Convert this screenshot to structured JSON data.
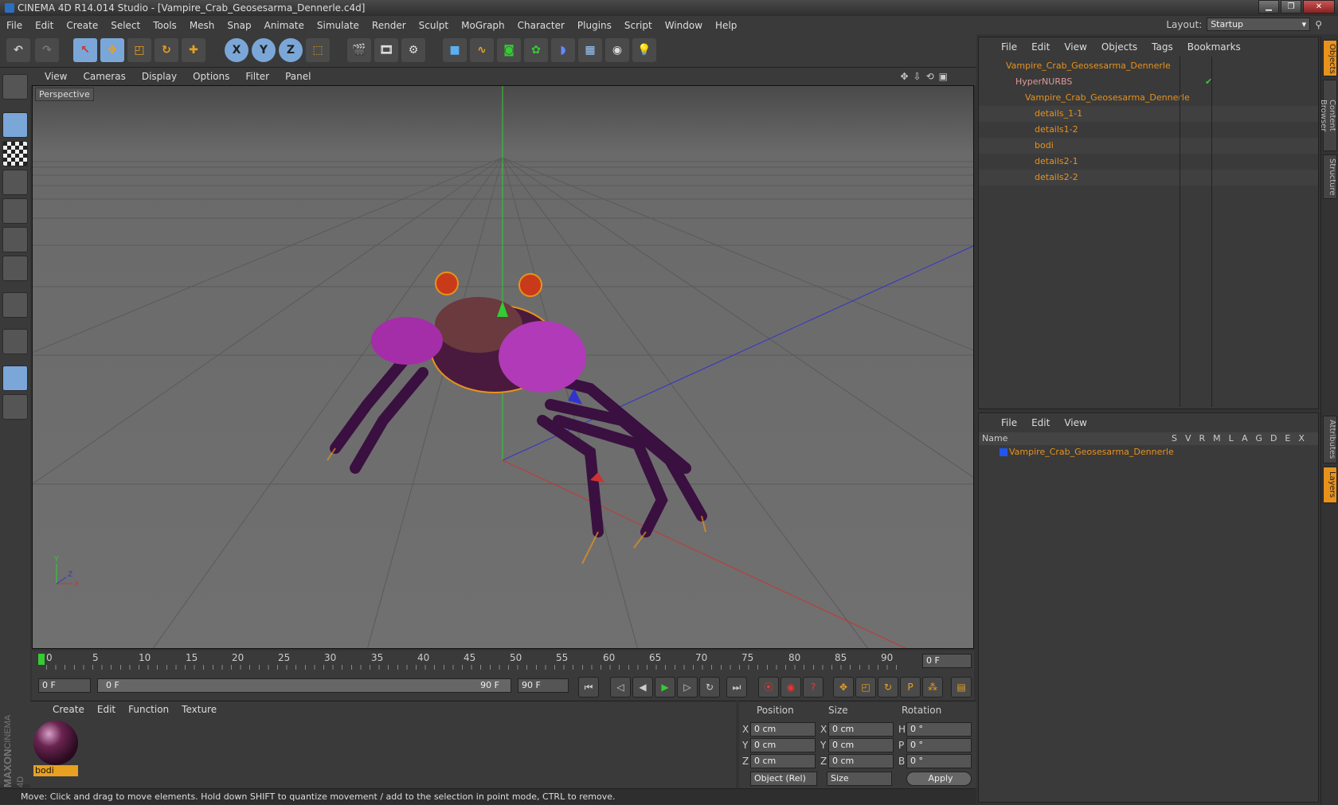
{
  "title": "CINEMA 4D R14.014 Studio - [Vampire_Crab_Geosesarma_Dennerle.c4d]",
  "menu": [
    "File",
    "Edit",
    "Create",
    "Select",
    "Tools",
    "Mesh",
    "Snap",
    "Animate",
    "Simulate",
    "Render",
    "Sculpt",
    "MoGraph",
    "Character",
    "Plugins",
    "Script",
    "Window",
    "Help"
  ],
  "layout": {
    "label": "Layout:",
    "value": "Startup"
  },
  "toolbar": {
    "x": "X",
    "y": "Y",
    "z": "Z"
  },
  "viewport": {
    "menu": [
      "View",
      "Cameras",
      "Display",
      "Options",
      "Filter",
      "Panel"
    ],
    "label": "Perspective",
    "axis_x": "X",
    "axis_y": "Y",
    "axis_z": "Z"
  },
  "timeline": {
    "ticks": [
      "0",
      "5",
      "10",
      "15",
      "20",
      "25",
      "30",
      "35",
      "40",
      "45",
      "50",
      "55",
      "60",
      "65",
      "70",
      "75",
      "80",
      "85",
      "90"
    ],
    "current": "0 F"
  },
  "transport": {
    "start": "0 F",
    "range_start": "0 F",
    "range_end": "90 F",
    "end": "90 F"
  },
  "materials": {
    "menu": [
      "Create",
      "Edit",
      "Function",
      "Texture"
    ],
    "items": [
      {
        "name": "bodi"
      }
    ]
  },
  "coords": {
    "headers": [
      "Position",
      "Size",
      "Rotation"
    ],
    "rows": [
      {
        "a": "X",
        "pos": "0 cm",
        "b": "X",
        "size": "0 cm",
        "c": "H",
        "rot": "0 °"
      },
      {
        "a": "Y",
        "pos": "0 cm",
        "b": "Y",
        "size": "0 cm",
        "c": "P",
        "rot": "0 °"
      },
      {
        "a": "Z",
        "pos": "0 cm",
        "b": "Z",
        "size": "0 cm",
        "c": "B",
        "rot": "0 °"
      }
    ],
    "mode": "Object (Rel)",
    "size_mode": "Size",
    "apply": "Apply"
  },
  "status": "Move: Click and drag to move elements. Hold down SHIFT to quantize movement / add to the selection in point mode, CTRL to remove.",
  "objects": {
    "menu": [
      "File",
      "Edit",
      "View",
      "Objects",
      "Tags",
      "Bookmarks"
    ],
    "tree": [
      {
        "name": "Vampire_Crab_Geosesarma_Dennerle"
      },
      {
        "name": "HyperNURBS"
      },
      {
        "name": "Vampire_Crab_Geosesarma_Dennerle"
      },
      {
        "name": "details_1-1"
      },
      {
        "name": "details1-2"
      },
      {
        "name": "bodi"
      },
      {
        "name": "details2-1"
      },
      {
        "name": "details2-2"
      }
    ]
  },
  "layers": {
    "menu": [
      "File",
      "Edit",
      "View"
    ],
    "name_header": "Name",
    "flags": [
      "S",
      "V",
      "R",
      "M",
      "L",
      "A",
      "G",
      "D",
      "E",
      "X"
    ],
    "rows": [
      {
        "name": "Vampire_Crab_Geosesarma_Dennerle"
      }
    ]
  },
  "side_tabs": [
    "Objects",
    "Content Browser",
    "Structure",
    "Attributes",
    "Layers"
  ],
  "maxon": "MAXON",
  "cinema": "CINEMA 4D"
}
